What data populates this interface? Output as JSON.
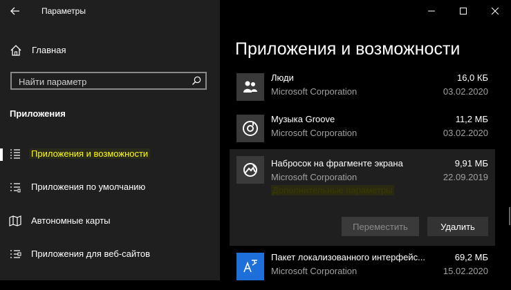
{
  "window": {
    "title": "Параметры",
    "controls": [
      "minimize-icon",
      "maximize-icon",
      "close-icon"
    ]
  },
  "sidebar": {
    "home_label": "Главная",
    "search": {
      "placeholder": "Найти параметр"
    },
    "section_title": "Приложения",
    "items": [
      {
        "label": "Приложения и возможности",
        "icon": "apps-list-icon",
        "active": true
      },
      {
        "label": "Приложения по умолчанию",
        "icon": "default-apps-icon",
        "active": false
      },
      {
        "label": "Автономные карты",
        "icon": "offline-maps-icon",
        "active": false
      },
      {
        "label": "Приложения для веб-сайтов",
        "icon": "apps-websites-icon",
        "active": false
      }
    ]
  },
  "main": {
    "title": "Приложения и возможности",
    "apps": [
      {
        "name": "Люди",
        "publisher": "Microsoft Corporation",
        "size": "16,0 КБ",
        "date": "03.02.2020",
        "icon": "people-icon"
      },
      {
        "name": "Музыка Groove",
        "publisher": "Microsoft Corporation",
        "size": "11,2 МБ",
        "date": "03.02.2020",
        "icon": "groove-music-icon"
      },
      {
        "name": "Набросок на фрагменте экрана",
        "publisher": "Microsoft Corporation",
        "size": "9,91 МБ",
        "date": "22.09.2019",
        "icon": "snip-sketch-icon",
        "advanced_link": "Дополнительные параметры",
        "move_label": "Переместить",
        "remove_label": "Удалить"
      },
      {
        "name": "Пакет локализованного интерфейс...",
        "publisher": "Microsoft Corporation",
        "size": "69,2 МБ",
        "date": "15.02.2020",
        "icon": "language-pack-icon"
      }
    ]
  }
}
